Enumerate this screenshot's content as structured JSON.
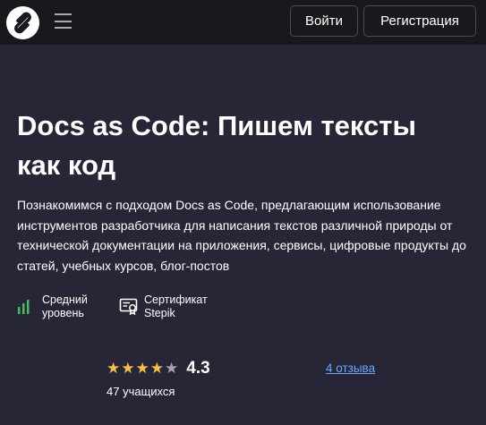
{
  "header": {
    "logo_icon": "stepik-logo-icon",
    "menu_icon": "hamburger-menu-icon",
    "login_label": "Войти",
    "register_label": "Регистрация"
  },
  "course": {
    "title": "Docs as Code: Пишем тексты как код",
    "description": "Познакомимся с подходом Docs as Code, предлагающим использование инструментов разработчика для написания текстов различной природы от технической документации на приложения, сервисы, цифровые продукты до статей, учебных курсов, блог-постов"
  },
  "features": {
    "level": {
      "icon": "level-bars-icon",
      "label": "Средний\nуровень"
    },
    "certificate": {
      "icon": "certificate-icon",
      "label": "Сертификат\nStepik"
    }
  },
  "rating": {
    "stars_filled": 4,
    "stars_total": 5,
    "value": "4.3",
    "learners": "47 учащихся",
    "reviews_link": "4 отзыва"
  },
  "colors": {
    "page_bg": "#262637",
    "header_bg": "#18181d",
    "star_on": "#f6c142",
    "star_off": "#a4a4ad",
    "link": "#6aa6ff",
    "level_green": "#3fbf5f"
  }
}
